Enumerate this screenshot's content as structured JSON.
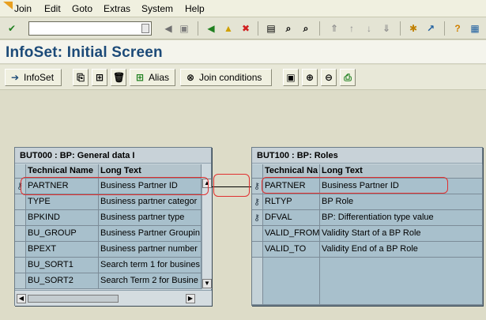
{
  "menu": {
    "items": [
      "Join",
      "Edit",
      "Goto",
      "Extras",
      "System",
      "Help"
    ]
  },
  "system_toolbar": {
    "command_value": "",
    "icons": [
      "enter-icon",
      "history-icon",
      "back-icon",
      "save-icon",
      "back-green-icon",
      "exit-icon",
      "cancel-icon",
      "print-icon",
      "find-icon",
      "find-next-icon",
      "first-page-icon",
      "prev-page-icon",
      "next-page-icon",
      "last-page-icon",
      "create-session-icon",
      "shortcut-icon",
      "help-icon",
      "customize-icon"
    ]
  },
  "title": "InfoSet: Initial Screen",
  "app_toolbar": {
    "infoset_label": "InfoSet",
    "alias_label": "Alias",
    "join_conditions_label": "Join conditions"
  },
  "table_left": {
    "title": "BUT000 : BP: General data I",
    "col_tech": "Technical Name",
    "col_long": "Long Text",
    "rows": [
      {
        "tech": "PARTNER",
        "long": "Business Partner ID",
        "key": true
      },
      {
        "tech": "TYPE",
        "long": "Business partner categor",
        "key": false
      },
      {
        "tech": "BPKIND",
        "long": "Business partner type",
        "key": false
      },
      {
        "tech": "BU_GROUP",
        "long": "Business Partner Groupin",
        "key": false
      },
      {
        "tech": "BPEXT",
        "long": "Business partner number",
        "key": false
      },
      {
        "tech": "BU_SORT1",
        "long": "Search term 1 for busines",
        "key": false
      },
      {
        "tech": "BU_SORT2",
        "long": "Search Term 2 for Busine",
        "key": false
      }
    ]
  },
  "table_right": {
    "title": "BUT100 : BP: Roles",
    "col_tech": "Technical Na",
    "col_long": "Long Text",
    "rows": [
      {
        "tech": "PARTNER",
        "long": "Business Partner ID",
        "key": true
      },
      {
        "tech": "RLTYP",
        "long": "BP Role",
        "key": true
      },
      {
        "tech": "DFVAL",
        "long": "BP: Differentiation type value",
        "key": true
      },
      {
        "tech": "VALID_FROM",
        "long": "Validity Start of a BP Role",
        "key": false
      },
      {
        "tech": "VALID_TO",
        "long": "Validity End of a BP Role",
        "key": false
      }
    ]
  },
  "colors": {
    "title": "#1c4a78",
    "highlight": "#e03030",
    "table_bg": "#a8c0cc"
  }
}
